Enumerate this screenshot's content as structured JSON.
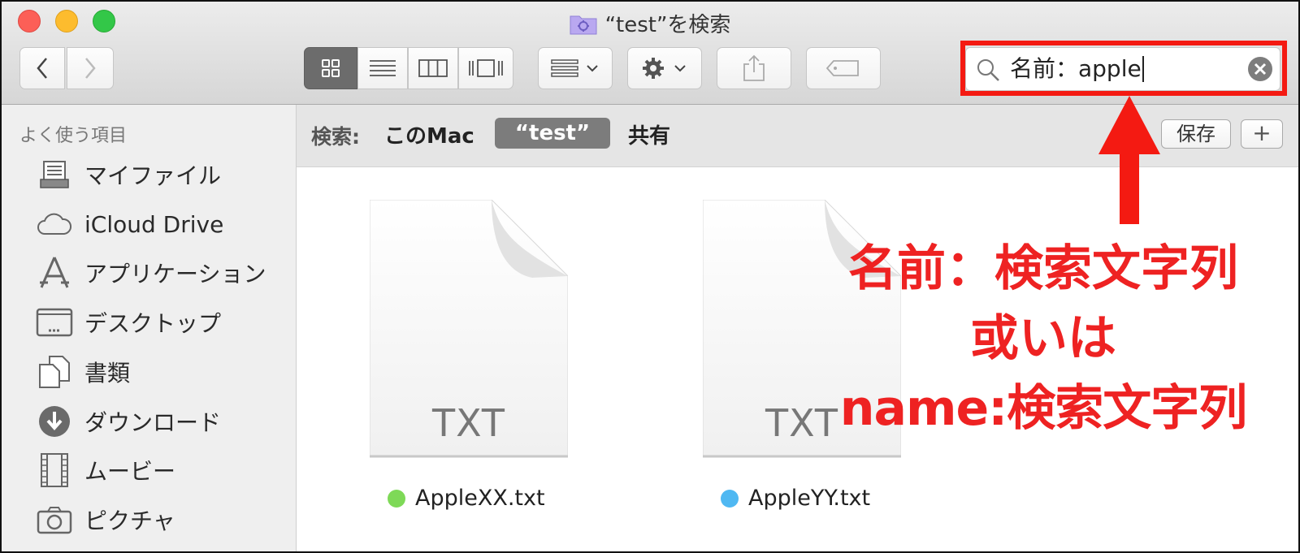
{
  "window": {
    "title": "“test”を検索"
  },
  "toolbar": {
    "view_modes": [
      "icon-view",
      "list-view",
      "column-view",
      "cover-flow-view"
    ],
    "search": {
      "value": "名前：apple"
    }
  },
  "scopebar": {
    "label": "検索:",
    "options": [
      "このMac",
      "“test”",
      "共有"
    ],
    "selected": "“test”",
    "save_label": "保存",
    "add_label": "+"
  },
  "sidebar": {
    "heading": "よく使う項目",
    "items": [
      {
        "label": "マイファイル",
        "icon": "all-my-files-icon"
      },
      {
        "label": "iCloud Drive",
        "icon": "icloud-icon"
      },
      {
        "label": "アプリケーション",
        "icon": "applications-icon"
      },
      {
        "label": "デスクトップ",
        "icon": "desktop-icon"
      },
      {
        "label": "書類",
        "icon": "documents-icon"
      },
      {
        "label": "ダウンロード",
        "icon": "downloads-icon"
      },
      {
        "label": "ムービー",
        "icon": "movies-icon"
      },
      {
        "label": "ピクチャ",
        "icon": "pictures-icon"
      }
    ]
  },
  "files": [
    {
      "name": "AppleXX.txt",
      "ext": "TXT",
      "tag_color": "#7ed957"
    },
    {
      "name": "AppleYY.txt",
      "ext": "TXT",
      "tag_color": "#4fb8f2"
    }
  ],
  "annotation": {
    "line1": "名前：検索文字列",
    "line2": "或いは",
    "line3": "name:検索文字列",
    "color": "#f41a12"
  }
}
